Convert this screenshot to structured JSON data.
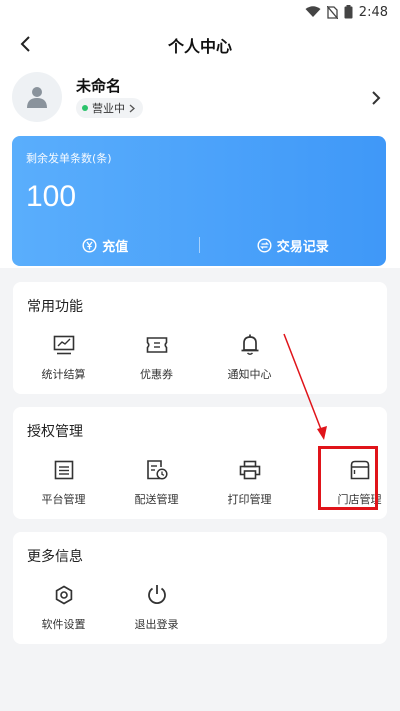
{
  "status_bar": {
    "time": "2:48"
  },
  "nav": {
    "title": "个人中心"
  },
  "profile": {
    "name": "未命名",
    "status": "营业中"
  },
  "quota": {
    "label": "剩余发单条数(条)",
    "value": "100",
    "recharge": "充值",
    "records": "交易记录"
  },
  "sections": {
    "common": {
      "title": "常用功能",
      "items": [
        {
          "label": "统计结算",
          "icon": "chart-icon"
        },
        {
          "label": "优惠券",
          "icon": "coupon-icon"
        },
        {
          "label": "通知中心",
          "icon": "bell-icon"
        }
      ]
    },
    "auth": {
      "title": "授权管理",
      "items": [
        {
          "label": "平台管理",
          "icon": "list-icon"
        },
        {
          "label": "配送管理",
          "icon": "delivery-icon"
        },
        {
          "label": "打印管理",
          "icon": "printer-icon"
        },
        {
          "label": "门店管理",
          "icon": "store-icon"
        }
      ]
    },
    "more": {
      "title": "更多信息",
      "items": [
        {
          "label": "软件设置",
          "icon": "settings-icon"
        },
        {
          "label": "退出登录",
          "icon": "power-icon"
        }
      ]
    }
  },
  "colors": {
    "accent": "#3f98f8",
    "highlight": "#e0141a",
    "status_green": "#2bc36b"
  }
}
